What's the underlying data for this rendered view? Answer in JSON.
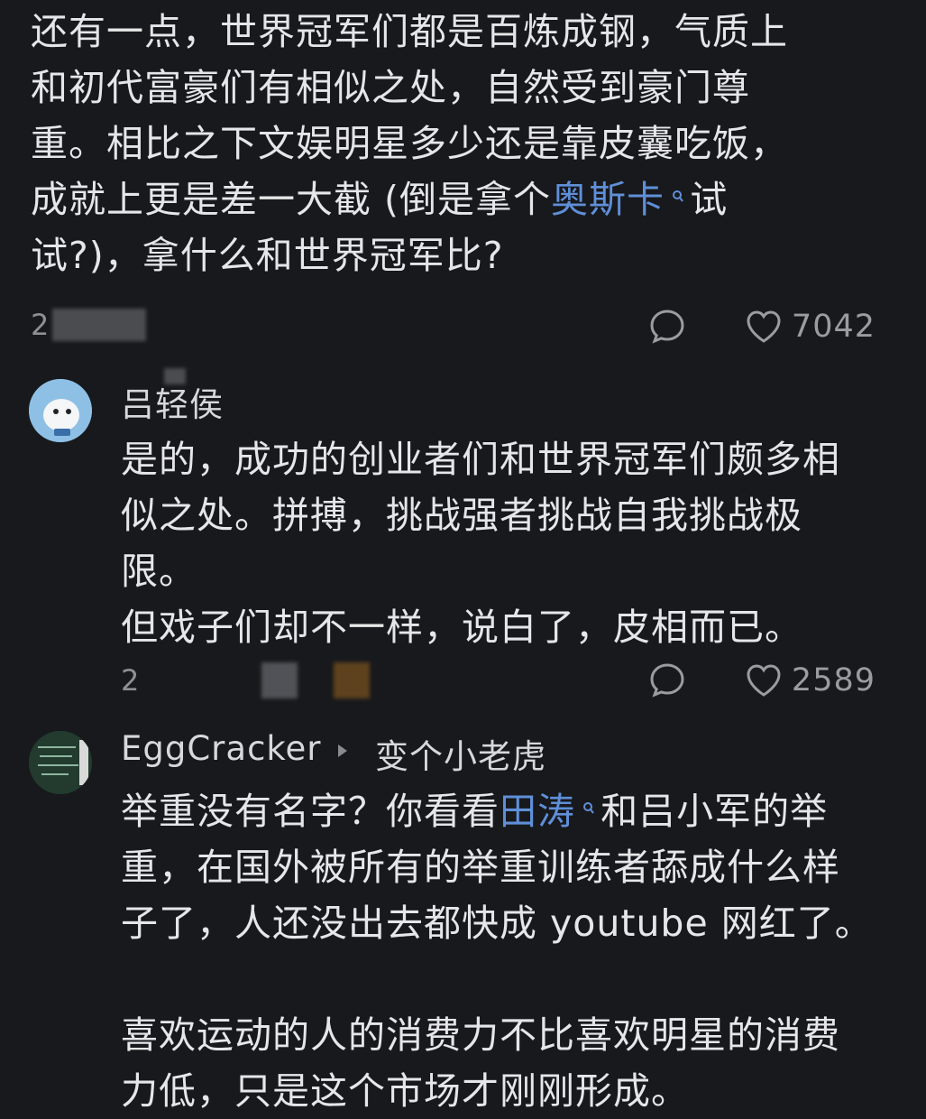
{
  "post": {
    "lines": [
      "还有一点，世界冠军们都是百炼成钢，气质上",
      "和初代富豪们有相似之处，自然受到豪门尊",
      "重。相比之下文娱明星多少还是靠皮囊吃饭，"
    ],
    "line4_prefix": "成就上更是差一大截 (倒是拿个",
    "line4_link": "奥斯卡",
    "line4_suffix": "试",
    "line5": "试?)，拿什么和世界冠军比?",
    "date_visible": "2",
    "like_count": "7042"
  },
  "comments": [
    {
      "username": "吕轻侯",
      "lines": [
        "是的，成功的创业者们和世界冠军们颇多相",
        "似之处。拼搏，挑战强者挑战自我挑战极",
        "限。",
        "但戏子们却不一样，说白了，皮相而已。"
      ],
      "date_visible": "2",
      "location_fragment": "...",
      "like_count": "2589"
    },
    {
      "username": "EggCracker",
      "reply_to": "变个小老虎",
      "line1_prefix": "举重没有名字？你看看",
      "line1_link": "田涛",
      "line1_suffix": "和吕小军的举",
      "lines_rest": [
        "重，在国外被所有的举重训练者舔成什么样",
        "子了，人还没出去都快成 youtube 网红了。"
      ],
      "lines_p2": [
        "喜欢运动的人的消费力不比喜欢明星的消费",
        "力低，只是这个市场才刚刚形成。"
      ]
    }
  ],
  "colors": {
    "background": "#18191c",
    "link": "#5f8fd8",
    "text": "#e6e6e8",
    "muted": "#8f8f94"
  },
  "icons": [
    "comment-icon",
    "heart-icon",
    "search-icon",
    "triangle-right-icon"
  ]
}
